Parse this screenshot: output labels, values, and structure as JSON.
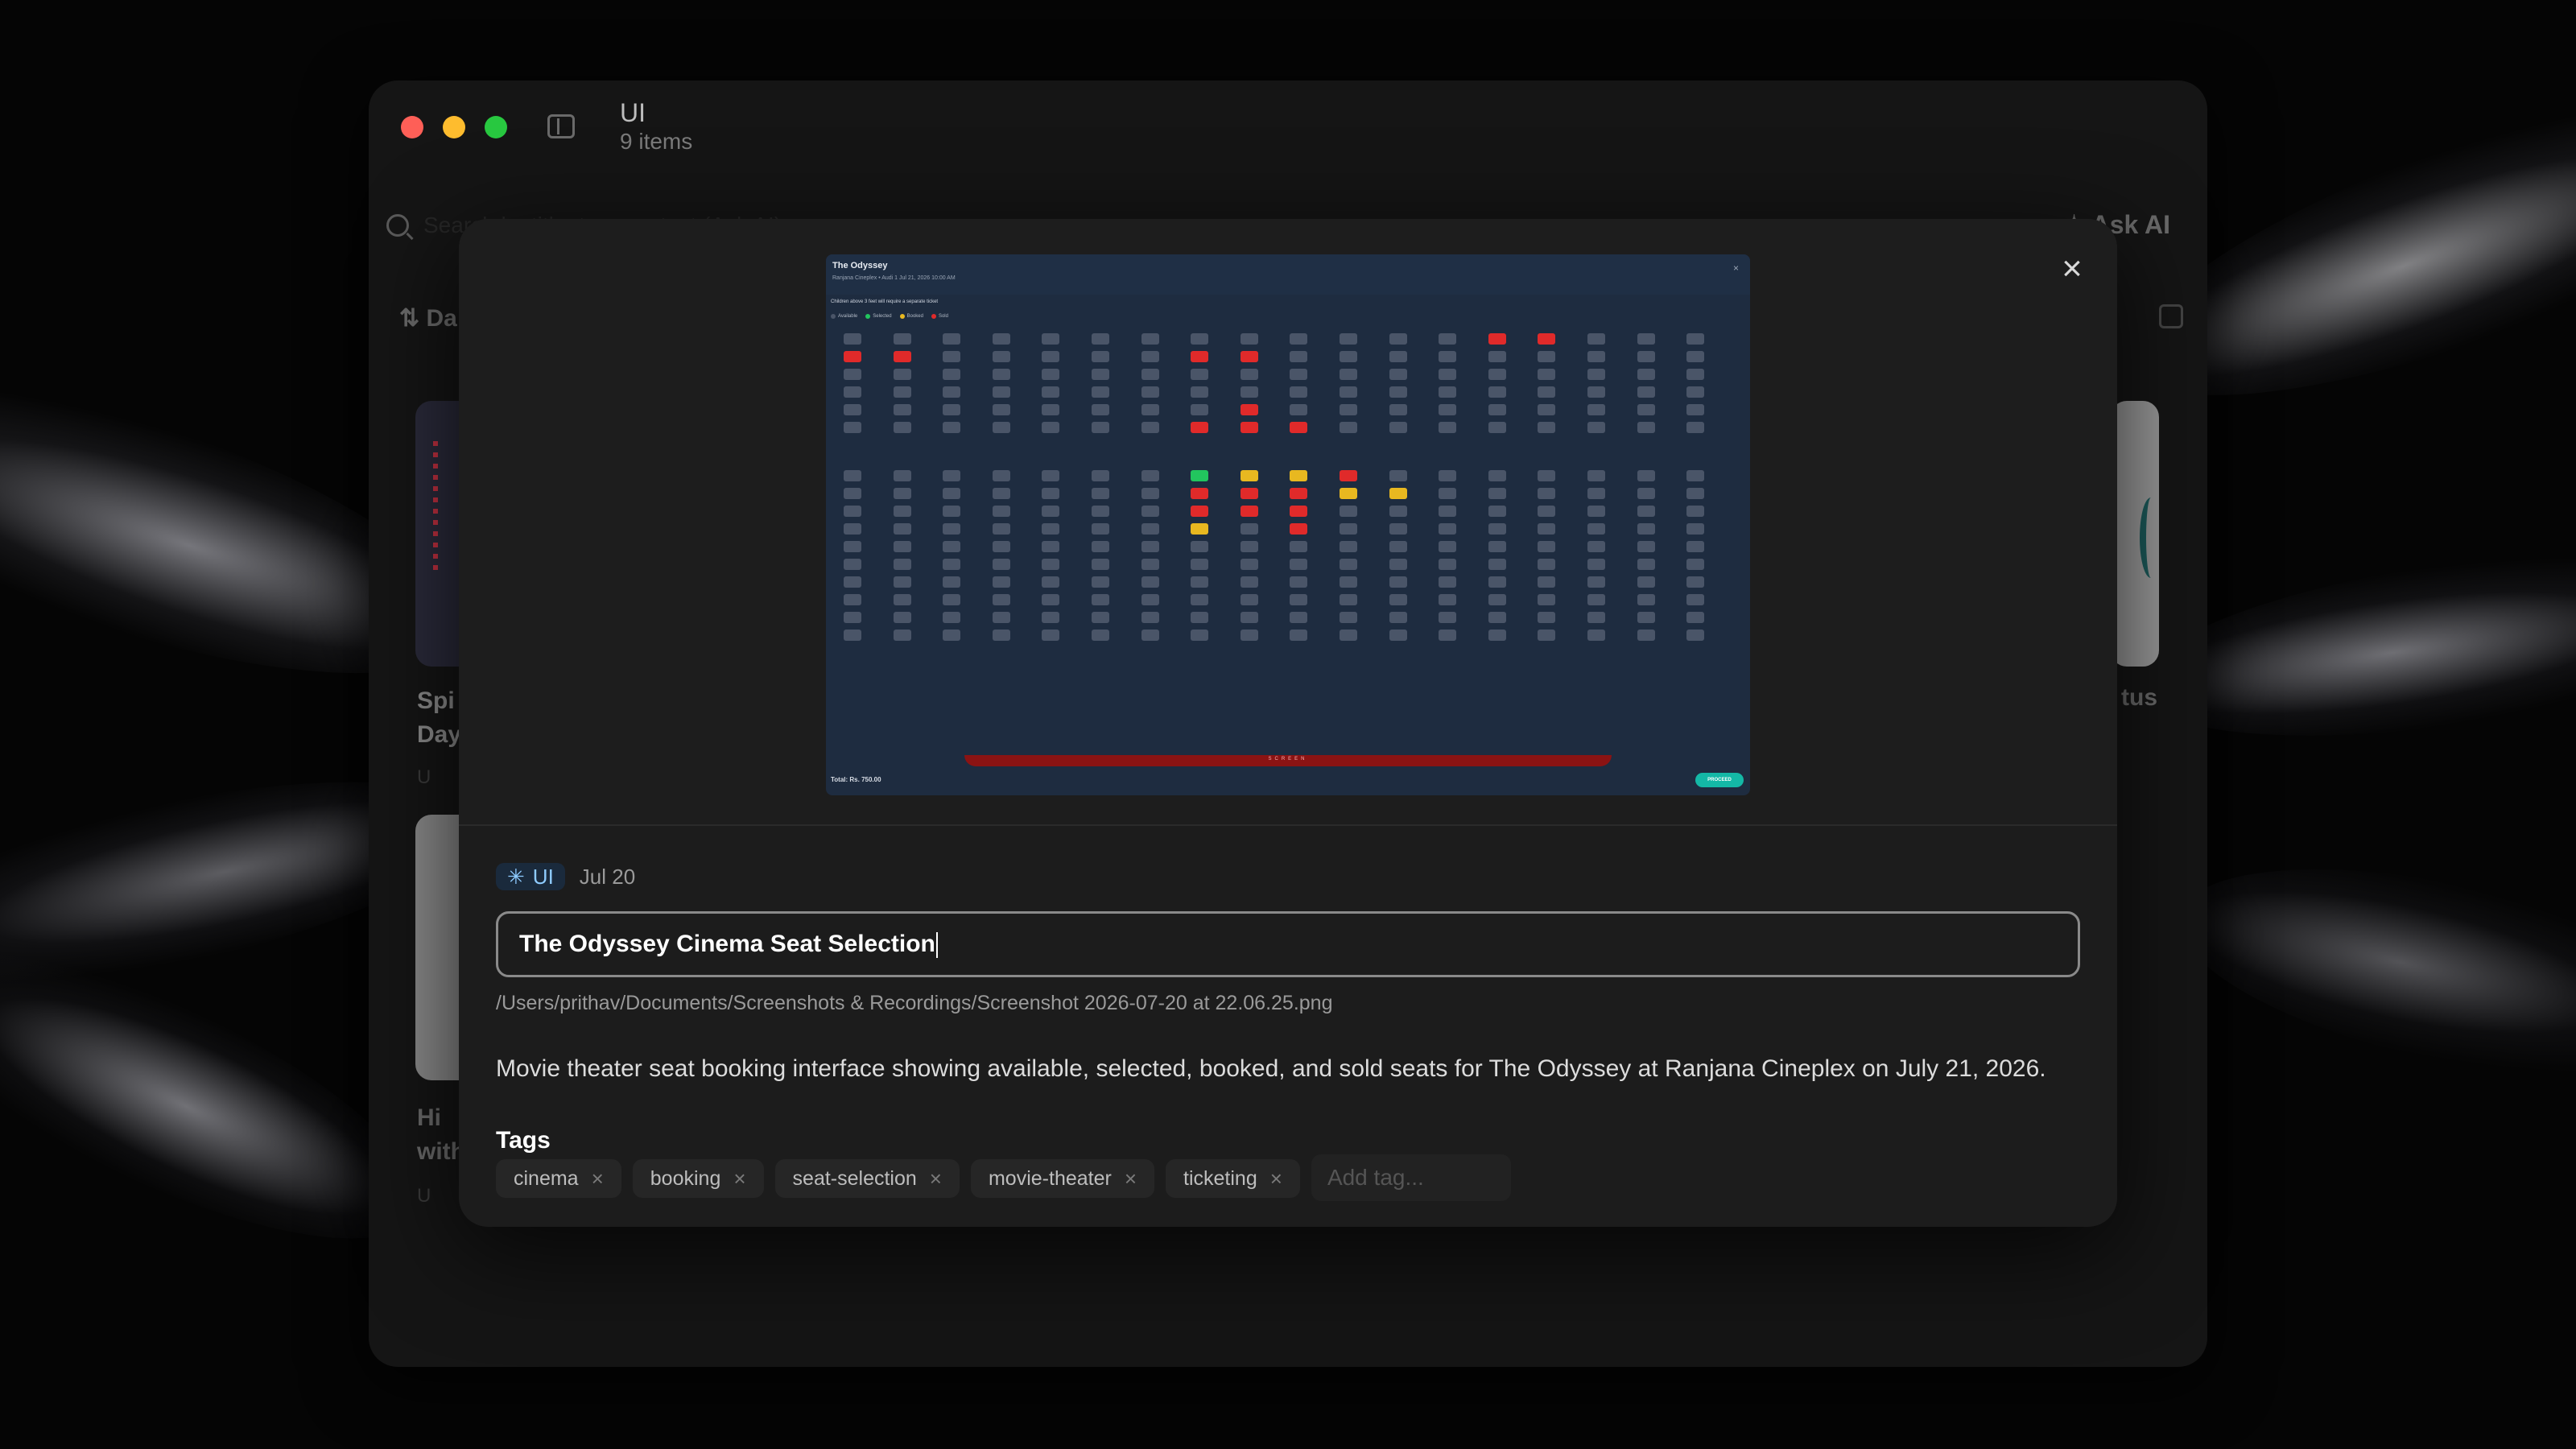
{
  "window": {
    "title": "UI",
    "subtitle": "9 items",
    "search_placeholder": "Search by title, tags, or text (Ask AI)",
    "ask_ai_label": "Ask AI",
    "sort_label": "Da",
    "bg_card_a_text": "Spi Day",
    "bg_card_b_text": "Hi with",
    "bg_card_c_text": "tus",
    "bg_card_tag": "U"
  },
  "preview": {
    "screenshot": {
      "title": "The Odyssey",
      "meta": "Ranjana Cineplex • Audi 1   Jul 21, 2026   10:00 AM",
      "note": "Children above 3 feet will require a separate ticket",
      "legend": [
        {
          "label": "Available",
          "color": "#4a5568"
        },
        {
          "label": "Selected",
          "color": "#22c55e"
        },
        {
          "label": "Booked",
          "color": "#e8b820"
        },
        {
          "label": "Sold",
          "color": "#e02a2a"
        }
      ],
      "screen_label": "SCREEN",
      "total": "Total: Rs. 750.00",
      "proceed": "PROCEED"
    }
  },
  "details": {
    "category": "UI",
    "date": "Jul 20",
    "title_value": "The Odyssey Cinema Seat Selection",
    "path": "/Users/prithav/Documents/Screenshots & Recordings/Screenshot 2026-07-20 at 22.06.25.png",
    "description": "Movie theater seat booking interface showing available, selected, booked, and sold seats for The Odyssey at Ranjana Cineplex on July 21, 2026.",
    "tags_label": "Tags",
    "tags": [
      "cinema",
      "booking",
      "seat-selection",
      "movie-theater",
      "ticketing"
    ],
    "tag_input_placeholder": "Add tag..."
  },
  "colors": {
    "accent": "#8ecbff",
    "booked": "#e02a2a",
    "selected": "#22c55e",
    "sold": "#e8b820",
    "proceed": "#14b8a6"
  }
}
